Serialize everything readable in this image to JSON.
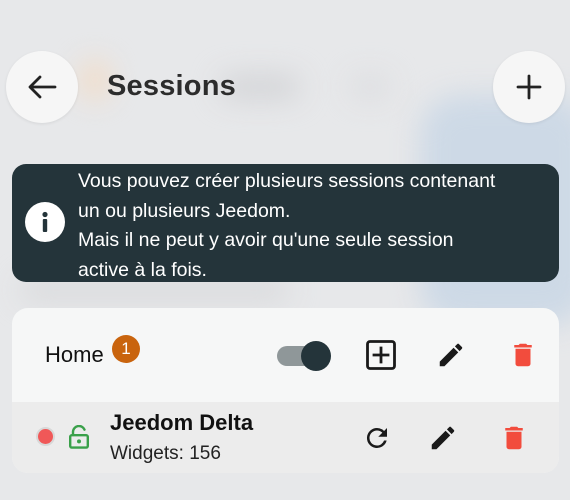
{
  "header": {
    "title": "Sessions",
    "back_icon": "arrow-left-icon",
    "add_icon": "plus-icon"
  },
  "info": {
    "icon": "info-icon",
    "line1": "Vous pouvez créer plusieurs sessions contenant",
    "line2": "un ou plusieurs Jeedom.",
    "line3": "Mais il ne peut y avoir qu'une seule session",
    "line4": "active à la fois."
  },
  "session": {
    "name": "Home",
    "badge_count": "1",
    "active": true,
    "jeedom": {
      "name": "Jeedom Delta",
      "widgets_label": "Widgets: 156",
      "status": "offline"
    }
  },
  "colors": {
    "banner": "#24343a",
    "badge": "#c9640e",
    "delete": "#f24c3d",
    "lock": "#3aa04a",
    "status_dot": "#f05858"
  }
}
